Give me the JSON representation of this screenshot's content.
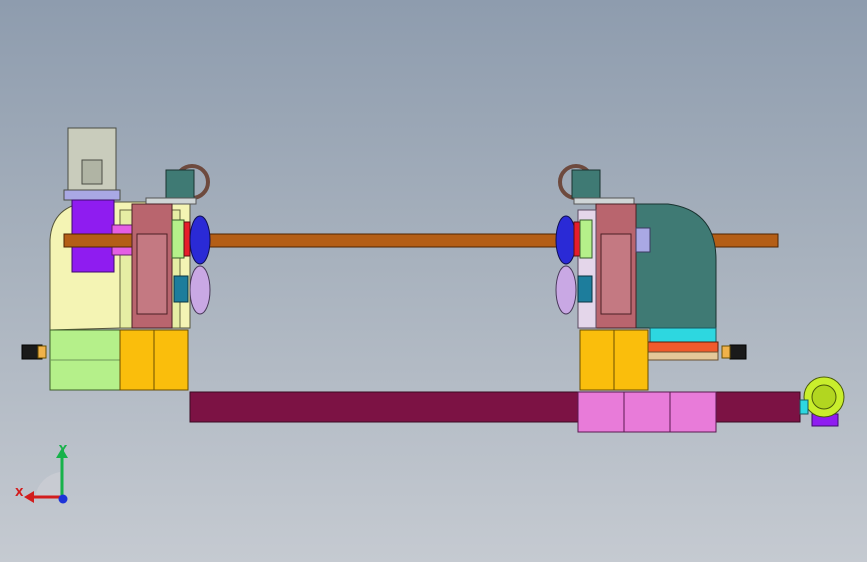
{
  "triad": {
    "x_label": "X",
    "y_label": "Y",
    "x_color": "#d21d1d",
    "y_color": "#17b24a",
    "z_color": "#1d33d8"
  },
  "colors": {
    "background_top": "#8e9cae",
    "background_bottom": "#c5cad1",
    "shaft": "#b45e16",
    "base_beam": "#7c1244",
    "left_housing": "#f4f4b4",
    "right_housing": "#3f7a74",
    "motor": "#c9ccbc",
    "gearbox": "#8f1cf0",
    "support_block": "#b9656e",
    "yellow_block": "#fabe0c",
    "green_block": "#b5f08a",
    "pink_block": "#e87bd9",
    "end_motor": "#c9ee2c"
  }
}
